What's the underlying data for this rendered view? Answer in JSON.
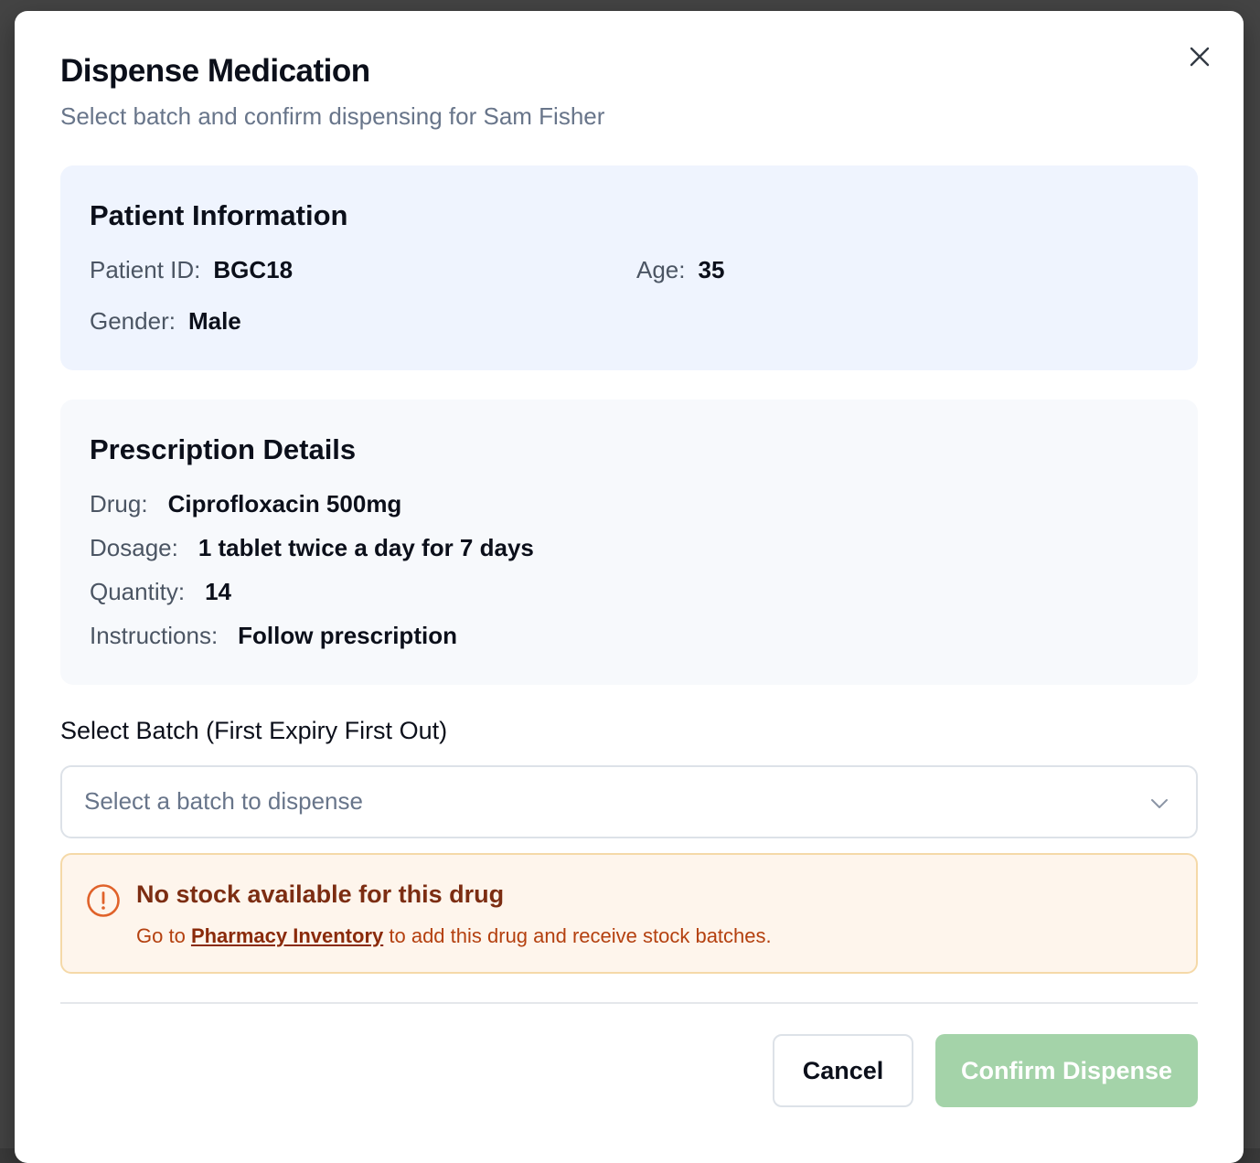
{
  "modal": {
    "title": "Dispense Medication",
    "subtitle": "Select batch and confirm dispensing for Sam Fisher"
  },
  "patient": {
    "section_title": "Patient Information",
    "id_label": "Patient ID:",
    "id_value": "BGC18",
    "age_label": "Age:",
    "age_value": "35",
    "gender_label": "Gender:",
    "gender_value": "Male"
  },
  "prescription": {
    "section_title": "Prescription Details",
    "drug_label": "Drug:",
    "drug_value": "Ciprofloxacin 500mg",
    "dosage_label": "Dosage:",
    "dosage_value": "1 tablet twice a day for 7 days",
    "quantity_label": "Quantity:",
    "quantity_value": "14",
    "instructions_label": "Instructions:",
    "instructions_value": "Follow prescription"
  },
  "batch": {
    "label": "Select Batch (First Expiry First Out)",
    "placeholder": "Select a batch to dispense",
    "icon": "chevron-down-icon"
  },
  "alert": {
    "icon": "alert-circle-icon",
    "title": "No stock available for this drug",
    "body_prefix": "Go to",
    "link_text": "Pharmacy Inventory",
    "body_suffix": "to add this drug and receive stock batches.",
    "colors": {
      "background": "#fef5ec",
      "border": "#f5d9a8",
      "title": "#7c2d12",
      "text": "#b4400f"
    }
  },
  "footer": {
    "cancel_label": "Cancel",
    "confirm_label": "Confirm Dispense",
    "confirm_color": "#a4d3a9",
    "confirm_disabled": true
  },
  "icons": {
    "close": "close-icon"
  }
}
